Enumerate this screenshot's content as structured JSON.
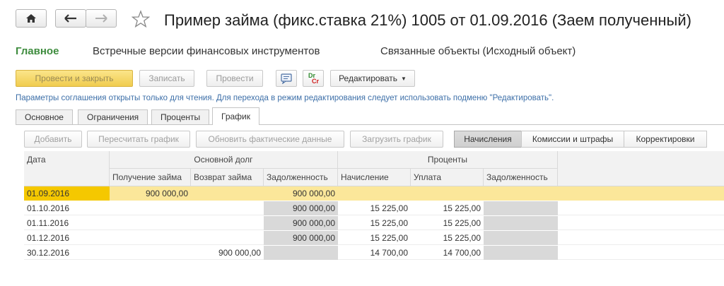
{
  "window": {
    "title": "Пример займа (фикс.ставка 21%) 1005 от 01.09.2016 (Заем полученный)"
  },
  "sections": [
    {
      "label": "Главное",
      "active": true
    },
    {
      "label": "Встречные версии финансовых инструментов",
      "active": false
    },
    {
      "label": "Связанные объекты (Исходный объект)",
      "active": false
    }
  ],
  "toolbar": {
    "post_close": "Провести и закрыть",
    "save": "Записать",
    "post": "Провести",
    "drcr_top": "Dr",
    "drcr_bottom": "Cr",
    "edit": "Редактировать"
  },
  "info_text": "Параметры соглашения открыты только для чтения. Для перехода в режим редактирования следует использовать подменю \"Редактировать\".",
  "tabs": [
    {
      "label": "Основное",
      "active": false
    },
    {
      "label": "Ограничения",
      "active": false
    },
    {
      "label": "Проценты",
      "active": false
    },
    {
      "label": "График",
      "active": true
    }
  ],
  "table_toolbar": {
    "add": "Добавить",
    "recalc": "Пересчитать график",
    "update_actual": "Обновить фактические данные",
    "load": "Загрузить график",
    "accruals": "Начисления",
    "commissions": "Комиссии и штрафы",
    "corrections": "Корректировки"
  },
  "grid": {
    "headers": {
      "date": "Дата",
      "principal_group": "Основной долг",
      "receipt": "Получение займа",
      "repayment": "Возврат займа",
      "principal_debt": "Задолженность",
      "interest_group": "Проценты",
      "accrual": "Начисление",
      "payment": "Уплата",
      "interest_debt": "Задолженность"
    },
    "rows": [
      {
        "date": "01.09.2016",
        "receipt": "900 000,00",
        "repayment": "",
        "principal_debt": "900 000,00",
        "accrual": "",
        "payment": "",
        "interest_debt": ""
      },
      {
        "date": "01.10.2016",
        "receipt": "",
        "repayment": "",
        "principal_debt": "900 000,00",
        "accrual": "15 225,00",
        "payment": "15 225,00",
        "interest_debt": ""
      },
      {
        "date": "01.11.2016",
        "receipt": "",
        "repayment": "",
        "principal_debt": "900 000,00",
        "accrual": "15 225,00",
        "payment": "15 225,00",
        "interest_debt": ""
      },
      {
        "date": "01.12.2016",
        "receipt": "",
        "repayment": "",
        "principal_debt": "900 000,00",
        "accrual": "15 225,00",
        "payment": "15 225,00",
        "interest_debt": ""
      },
      {
        "date": "30.12.2016",
        "receipt": "",
        "repayment": "900 000,00",
        "principal_debt": "",
        "accrual": "14 700,00",
        "payment": "14 700,00",
        "interest_debt": ""
      }
    ]
  },
  "colors": {
    "active_section": "#3e8c3e",
    "primary_button": "#f0cc4f",
    "selected_row": "#fbe79a",
    "selected_date_cell": "#f5c800",
    "info_text": "#3d6fa8"
  }
}
